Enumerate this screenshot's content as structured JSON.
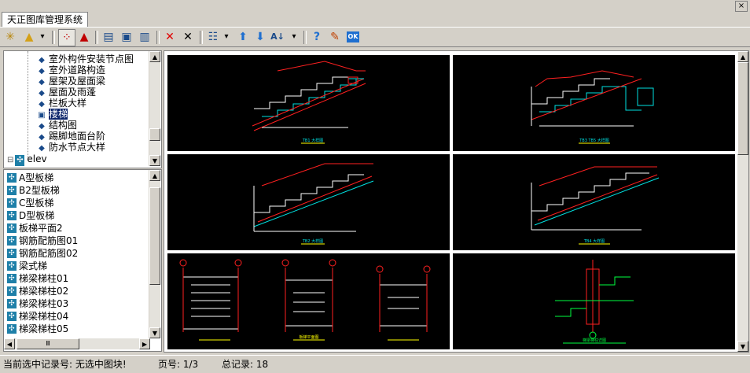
{
  "window": {
    "tab_label": "天正图库管理系统",
    "close_glyph": "×"
  },
  "toolbar": {
    "buttons": [
      {
        "name": "new-library-icon",
        "glyph": "✳"
      },
      {
        "name": "open-library-icon",
        "glyph": "▲"
      },
      {
        "name": "dropdown-arrow-icon",
        "glyph": "▾"
      },
      {
        "name": "layout-view-icon",
        "glyph": "⁘"
      },
      {
        "name": "triangle-view-icon",
        "glyph": "▲"
      },
      {
        "name": "import-icon",
        "glyph": "▤"
      },
      {
        "name": "replace-icon",
        "glyph": "▣"
      },
      {
        "name": "insert-icon",
        "glyph": "▥"
      },
      {
        "name": "delete-red-icon",
        "glyph": "✕"
      },
      {
        "name": "delete-icon",
        "glyph": "✕"
      },
      {
        "name": "view-mode-icon",
        "glyph": "☷"
      },
      {
        "name": "view-mode-dropdown-icon",
        "glyph": "▾"
      },
      {
        "name": "move-up-icon",
        "glyph": "⬆"
      },
      {
        "name": "move-down-icon",
        "glyph": "⬇"
      },
      {
        "name": "sort-icon",
        "glyph": "A↓"
      },
      {
        "name": "sort-dropdown-icon",
        "glyph": "▾"
      },
      {
        "name": "help-icon",
        "glyph": "?"
      },
      {
        "name": "edit-icon",
        "glyph": "✎"
      },
      {
        "name": "ok-icon",
        "glyph": "OK"
      }
    ]
  },
  "tree": {
    "items": [
      {
        "label": "室外构件安装节点图",
        "selected": false
      },
      {
        "label": "室外道路构造",
        "selected": false
      },
      {
        "label": "屋架及屋面梁",
        "selected": false
      },
      {
        "label": "屋面及雨蓬",
        "selected": false
      },
      {
        "label": "栏板大样",
        "selected": false
      },
      {
        "label": "楼梯",
        "selected": true
      },
      {
        "label": "结构图",
        "selected": false
      },
      {
        "label": "踢脚地面台阶",
        "selected": false
      },
      {
        "label": "防水节点大样",
        "selected": false
      }
    ],
    "root_item": {
      "label": "elev",
      "expander": "⊟"
    }
  },
  "list": {
    "items": [
      "A型板梯",
      "B2型板梯",
      "C型板梯",
      "D型板梯",
      "板梯平面2",
      "钢筋配筋图01",
      "钢筋配筋图02",
      "梁式梯",
      "梯梁梯柱01",
      "梯梁梯柱02",
      "梯梁梯柱03",
      "梯梁梯柱04",
      "梯梁梯柱05"
    ],
    "hscroll_thumb": "Ⅲ"
  },
  "preview": {
    "cells": [
      {
        "caption": "TB1 大样图"
      },
      {
        "caption": "TB3 TB5 大样图"
      },
      {
        "caption": "TB2 大样图"
      },
      {
        "caption": "TB4 大样图"
      },
      {
        "caption": "板梯平面图"
      },
      {
        "caption": "梯梁梯柱详图"
      }
    ]
  },
  "status": {
    "selection": "当前选中记录号: 无选中图块!",
    "page": "页号: 1/3",
    "total": "总记录:  18"
  },
  "colors": {
    "selection_bg": "#0a246a",
    "cad_background": "#000000",
    "cad_red": "#ff2020",
    "cad_cyan": "#00e0e0",
    "cad_white": "#ffffff",
    "cad_yellow": "#ffff00",
    "cad_green": "#00ff40"
  }
}
